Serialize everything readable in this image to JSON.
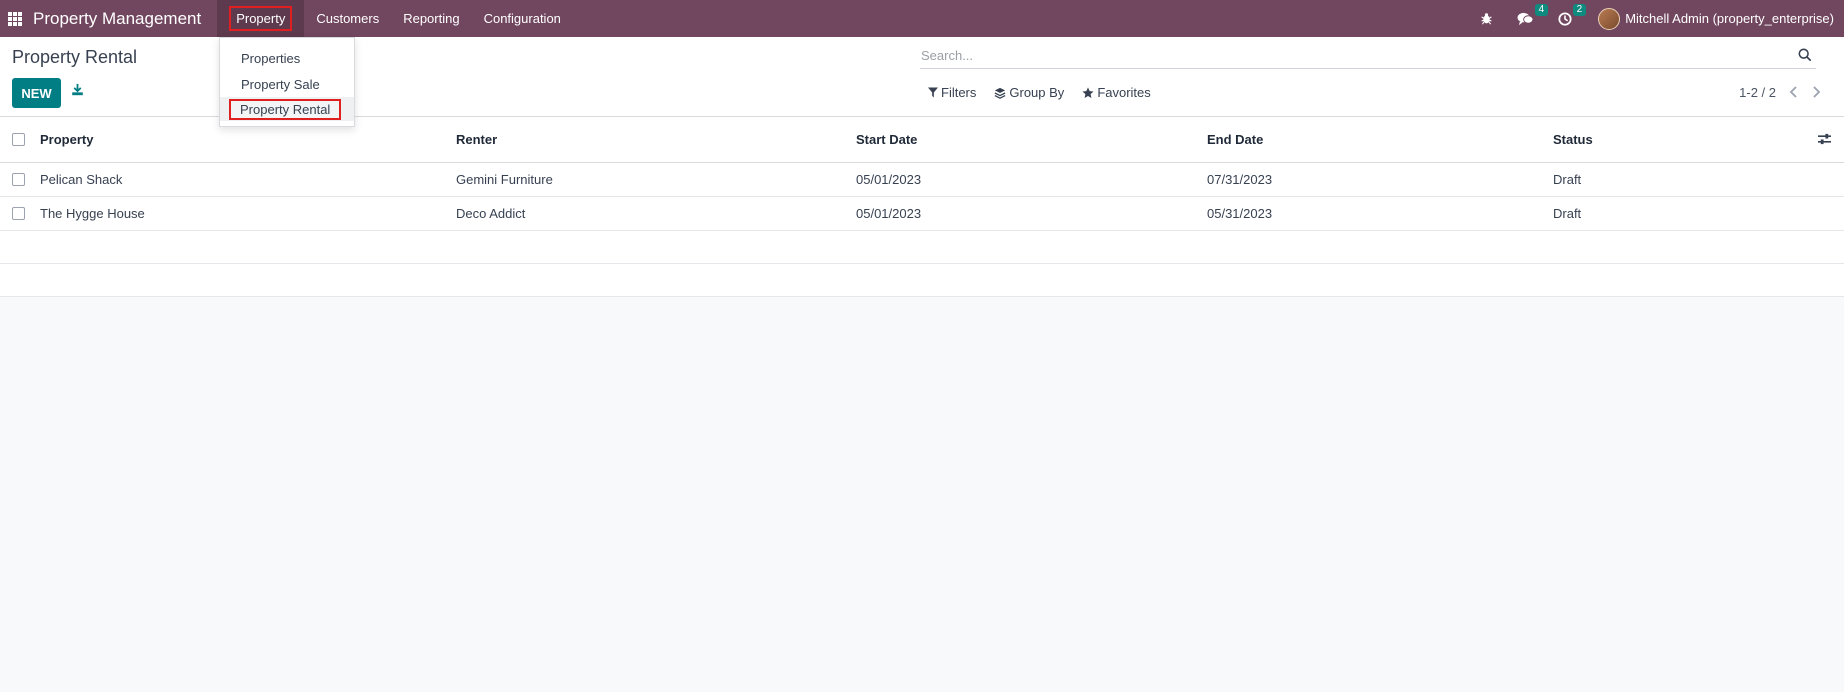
{
  "navbar": {
    "brand": "Property Management",
    "menu": [
      {
        "label": "Property"
      },
      {
        "label": "Customers"
      },
      {
        "label": "Reporting"
      },
      {
        "label": "Configuration"
      }
    ],
    "messages_count": "4",
    "activities_count": "2",
    "user": "Mitchell Admin (property_enterprise)"
  },
  "dropdown": {
    "items": [
      {
        "label": "Properties"
      },
      {
        "label": "Property Sale"
      },
      {
        "label": "Property Rental"
      }
    ]
  },
  "control": {
    "title": "Property Rental",
    "new_label": "NEW",
    "search_placeholder": "Search...",
    "filters_label": "Filters",
    "groupby_label": "Group By",
    "favorites_label": "Favorites",
    "pager": "1-2 / 2"
  },
  "table": {
    "headers": {
      "property": "Property",
      "renter": "Renter",
      "start": "Start Date",
      "end": "End Date",
      "status": "Status"
    },
    "rows": [
      {
        "property": "Pelican Shack",
        "renter": "Gemini Furniture",
        "start": "05/01/2023",
        "end": "07/31/2023",
        "status": "Draft"
      },
      {
        "property": "The Hygge House",
        "renter": "Deco Addict",
        "start": "05/01/2023",
        "end": "05/31/2023",
        "status": "Draft"
      }
    ]
  },
  "colors": {
    "navbar": "#71465f",
    "primary": "#017e84",
    "badge": "#0f8a7e",
    "highlight": "#e02020"
  }
}
